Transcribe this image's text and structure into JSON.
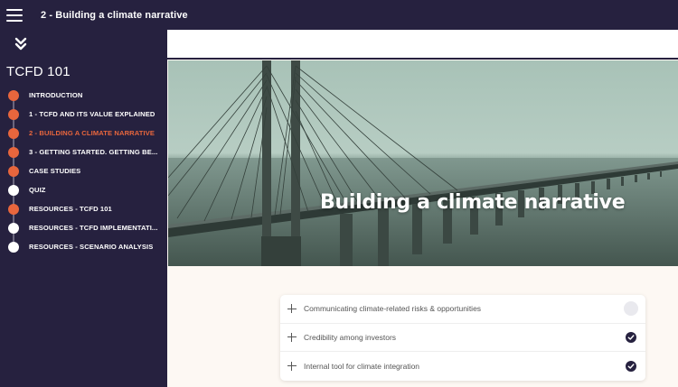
{
  "header": {
    "title": "2 - Building a climate narrative",
    "menu_icon": "hamburger-menu-icon"
  },
  "sidebar": {
    "collapse_icon": "double-chevron-down-icon",
    "course_title": "TCFD 101",
    "items": [
      {
        "label": "INTRODUCTION",
        "status": "complete"
      },
      {
        "label": "1 - TCFD AND ITS VALUE EXPLAINED",
        "status": "complete"
      },
      {
        "label": "2 - BUILDING A CLIMATE NARRATIVE",
        "status": "current"
      },
      {
        "label": "3 - GETTING STARTED. GETTING BE...",
        "status": "complete"
      },
      {
        "label": "CASE STUDIES",
        "status": "complete"
      },
      {
        "label": "QUIZ",
        "status": "incomplete"
      },
      {
        "label": "RESOURCES - TCFD 101",
        "status": "complete"
      },
      {
        "label": "RESOURCES - TCFD IMPLEMENTATI...",
        "status": "incomplete"
      },
      {
        "label": "RESOURCES - SCENARIO ANALYSIS",
        "status": "incomplete"
      }
    ]
  },
  "hero": {
    "title": "Building a climate narrative"
  },
  "accordion": {
    "items": [
      {
        "label": "Communicating climate-related risks & opportunities",
        "status": "pending"
      },
      {
        "label": "Credibility among investors",
        "status": "done"
      },
      {
        "label": "Internal tool for climate integration",
        "status": "done"
      }
    ]
  },
  "colors": {
    "navy": "#26213f",
    "accent": "#e8663d",
    "background": "#fdf8f3"
  }
}
